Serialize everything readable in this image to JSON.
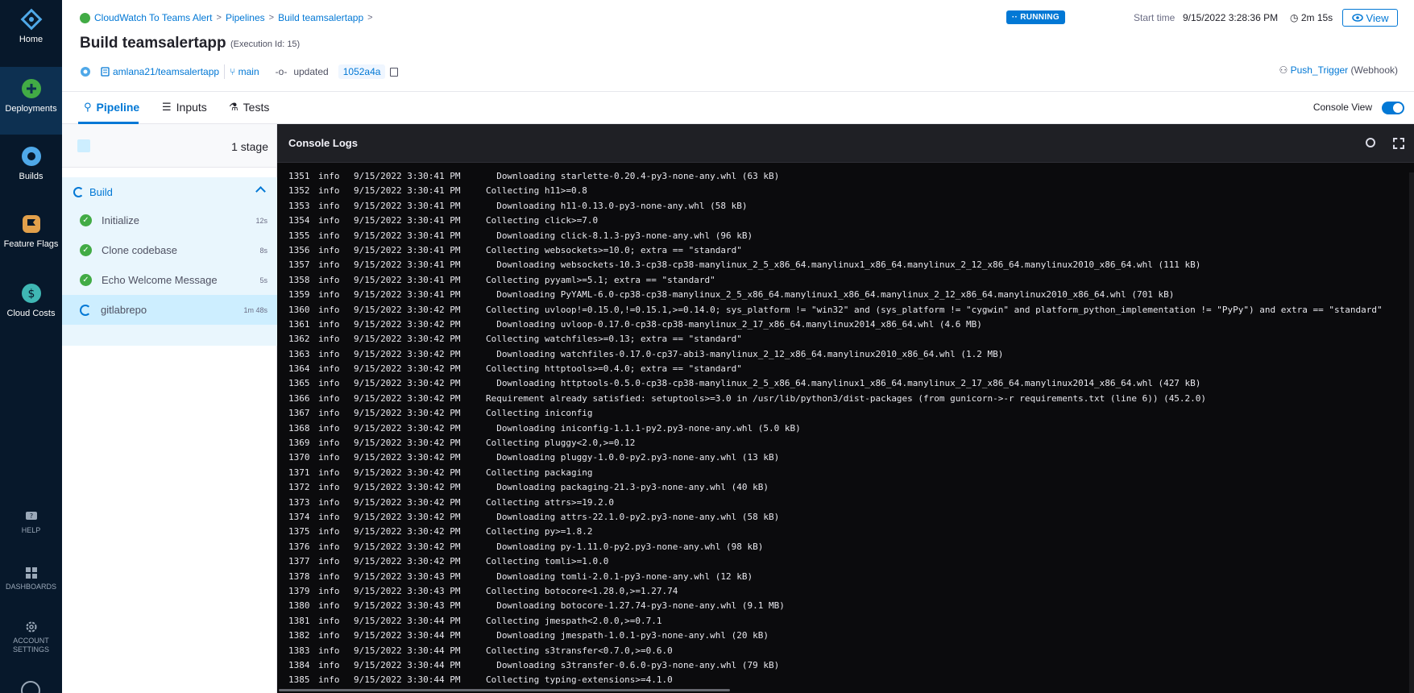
{
  "nav": {
    "home": "Home",
    "deployments": "Deployments",
    "builds": "Builds",
    "feature_flags": "Feature Flags",
    "cloud_costs": "Cloud Costs",
    "help": "HELP",
    "dashboards": "DASHBOARDS",
    "account_settings": "ACCOUNT SETTINGS"
  },
  "breadcrumbs": [
    "CloudWatch To Teams Alert",
    "Pipelines",
    "Build teamsalertapp"
  ],
  "header": {
    "title": "Build teamsalertapp",
    "execution_id": "(Execution Id: 15)",
    "repo": "amlana21/teamsalertapp",
    "branch": "main",
    "updated_label": "updated",
    "commit": "1052a4a",
    "status": "RUNNING",
    "start_time_label": "Start time",
    "start_time": "9/15/2022 3:28:36 PM",
    "duration": "2m 15s",
    "view_label": "View",
    "trigger_name": "Push_Trigger",
    "trigger_type": "(Webhook)"
  },
  "tabs": {
    "pipeline": "Pipeline",
    "inputs": "Inputs",
    "tests": "Tests",
    "console_view": "Console View"
  },
  "stages": {
    "count": "1 stage",
    "group": "Build",
    "steps": [
      {
        "name": "Initialize",
        "time": "12s",
        "status": "success"
      },
      {
        "name": "Clone codebase",
        "time": "8s",
        "status": "success"
      },
      {
        "name": "Echo Welcome Message",
        "time": "5s",
        "status": "success"
      },
      {
        "name": "gitlabrepo",
        "time": "1m 48s",
        "status": "running"
      }
    ]
  },
  "console": {
    "title": "Console Logs",
    "lines": [
      {
        "n": "1351",
        "lv": "info",
        "ts": "9/15/2022 3:30:41 PM",
        "tx": "  Downloading starlette-0.20.4-py3-none-any.whl (63 kB)"
      },
      {
        "n": "1352",
        "lv": "info",
        "ts": "9/15/2022 3:30:41 PM",
        "tx": "Collecting h11>=0.8"
      },
      {
        "n": "1353",
        "lv": "info",
        "ts": "9/15/2022 3:30:41 PM",
        "tx": "  Downloading h11-0.13.0-py3-none-any.whl (58 kB)"
      },
      {
        "n": "1354",
        "lv": "info",
        "ts": "9/15/2022 3:30:41 PM",
        "tx": "Collecting click>=7.0"
      },
      {
        "n": "1355",
        "lv": "info",
        "ts": "9/15/2022 3:30:41 PM",
        "tx": "  Downloading click-8.1.3-py3-none-any.whl (96 kB)"
      },
      {
        "n": "1356",
        "lv": "info",
        "ts": "9/15/2022 3:30:41 PM",
        "tx": "Collecting websockets>=10.0; extra == \"standard\""
      },
      {
        "n": "1357",
        "lv": "info",
        "ts": "9/15/2022 3:30:41 PM",
        "tx": "  Downloading websockets-10.3-cp38-cp38-manylinux_2_5_x86_64.manylinux1_x86_64.manylinux_2_12_x86_64.manylinux2010_x86_64.whl (111 kB)"
      },
      {
        "n": "1358",
        "lv": "info",
        "ts": "9/15/2022 3:30:41 PM",
        "tx": "Collecting pyyaml>=5.1; extra == \"standard\""
      },
      {
        "n": "1359",
        "lv": "info",
        "ts": "9/15/2022 3:30:41 PM",
        "tx": "  Downloading PyYAML-6.0-cp38-cp38-manylinux_2_5_x86_64.manylinux1_x86_64.manylinux_2_12_x86_64.manylinux2010_x86_64.whl (701 kB)"
      },
      {
        "n": "1360",
        "lv": "info",
        "ts": "9/15/2022 3:30:42 PM",
        "tx": "Collecting uvloop!=0.15.0,!=0.15.1,>=0.14.0; sys_platform != \"win32\" and (sys_platform != \"cygwin\" and platform_python_implementation != \"PyPy\") and extra == \"standard\""
      },
      {
        "n": "1361",
        "lv": "info",
        "ts": "9/15/2022 3:30:42 PM",
        "tx": "  Downloading uvloop-0.17.0-cp38-cp38-manylinux_2_17_x86_64.manylinux2014_x86_64.whl (4.6 MB)"
      },
      {
        "n": "1362",
        "lv": "info",
        "ts": "9/15/2022 3:30:42 PM",
        "tx": "Collecting watchfiles>=0.13; extra == \"standard\""
      },
      {
        "n": "1363",
        "lv": "info",
        "ts": "9/15/2022 3:30:42 PM",
        "tx": "  Downloading watchfiles-0.17.0-cp37-abi3-manylinux_2_12_x86_64.manylinux2010_x86_64.whl (1.2 MB)"
      },
      {
        "n": "1364",
        "lv": "info",
        "ts": "9/15/2022 3:30:42 PM",
        "tx": "Collecting httptools>=0.4.0; extra == \"standard\""
      },
      {
        "n": "1365",
        "lv": "info",
        "ts": "9/15/2022 3:30:42 PM",
        "tx": "  Downloading httptools-0.5.0-cp38-cp38-manylinux_2_5_x86_64.manylinux1_x86_64.manylinux_2_17_x86_64.manylinux2014_x86_64.whl (427 kB)"
      },
      {
        "n": "1366",
        "lv": "info",
        "ts": "9/15/2022 3:30:42 PM",
        "tx": "Requirement already satisfied: setuptools>=3.0 in /usr/lib/python3/dist-packages (from gunicorn->-r requirements.txt (line 6)) (45.2.0)"
      },
      {
        "n": "1367",
        "lv": "info",
        "ts": "9/15/2022 3:30:42 PM",
        "tx": "Collecting iniconfig"
      },
      {
        "n": "1368",
        "lv": "info",
        "ts": "9/15/2022 3:30:42 PM",
        "tx": "  Downloading iniconfig-1.1.1-py2.py3-none-any.whl (5.0 kB)"
      },
      {
        "n": "1369",
        "lv": "info",
        "ts": "9/15/2022 3:30:42 PM",
        "tx": "Collecting pluggy<2.0,>=0.12"
      },
      {
        "n": "1370",
        "lv": "info",
        "ts": "9/15/2022 3:30:42 PM",
        "tx": "  Downloading pluggy-1.0.0-py2.py3-none-any.whl (13 kB)"
      },
      {
        "n": "1371",
        "lv": "info",
        "ts": "9/15/2022 3:30:42 PM",
        "tx": "Collecting packaging"
      },
      {
        "n": "1372",
        "lv": "info",
        "ts": "9/15/2022 3:30:42 PM",
        "tx": "  Downloading packaging-21.3-py3-none-any.whl (40 kB)"
      },
      {
        "n": "1373",
        "lv": "info",
        "ts": "9/15/2022 3:30:42 PM",
        "tx": "Collecting attrs>=19.2.0"
      },
      {
        "n": "1374",
        "lv": "info",
        "ts": "9/15/2022 3:30:42 PM",
        "tx": "  Downloading attrs-22.1.0-py2.py3-none-any.whl (58 kB)"
      },
      {
        "n": "1375",
        "lv": "info",
        "ts": "9/15/2022 3:30:42 PM",
        "tx": "Collecting py>=1.8.2"
      },
      {
        "n": "1376",
        "lv": "info",
        "ts": "9/15/2022 3:30:42 PM",
        "tx": "  Downloading py-1.11.0-py2.py3-none-any.whl (98 kB)"
      },
      {
        "n": "1377",
        "lv": "info",
        "ts": "9/15/2022 3:30:42 PM",
        "tx": "Collecting tomli>=1.0.0"
      },
      {
        "n": "1378",
        "lv": "info",
        "ts": "9/15/2022 3:30:43 PM",
        "tx": "  Downloading tomli-2.0.1-py3-none-any.whl (12 kB)"
      },
      {
        "n": "1379",
        "lv": "info",
        "ts": "9/15/2022 3:30:43 PM",
        "tx": "Collecting botocore<1.28.0,>=1.27.74"
      },
      {
        "n": "1380",
        "lv": "info",
        "ts": "9/15/2022 3:30:43 PM",
        "tx": "  Downloading botocore-1.27.74-py3-none-any.whl (9.1 MB)"
      },
      {
        "n": "1381",
        "lv": "info",
        "ts": "9/15/2022 3:30:44 PM",
        "tx": "Collecting jmespath<2.0.0,>=0.7.1"
      },
      {
        "n": "1382",
        "lv": "info",
        "ts": "9/15/2022 3:30:44 PM",
        "tx": "  Downloading jmespath-1.0.1-py3-none-any.whl (20 kB)"
      },
      {
        "n": "1383",
        "lv": "info",
        "ts": "9/15/2022 3:30:44 PM",
        "tx": "Collecting s3transfer<0.7.0,>=0.6.0"
      },
      {
        "n": "1384",
        "lv": "info",
        "ts": "9/15/2022 3:30:44 PM",
        "tx": "  Downloading s3transfer-0.6.0-py3-none-any.whl (79 kB)"
      },
      {
        "n": "1385",
        "lv": "info",
        "ts": "9/15/2022 3:30:44 PM",
        "tx": "Collecting typing-extensions>=4.1.0"
      }
    ]
  },
  "colors": {
    "nav_bg": "#07182b",
    "accent": "#0278d5",
    "success": "#42ab45",
    "console_bg": "#0b0b0d"
  }
}
